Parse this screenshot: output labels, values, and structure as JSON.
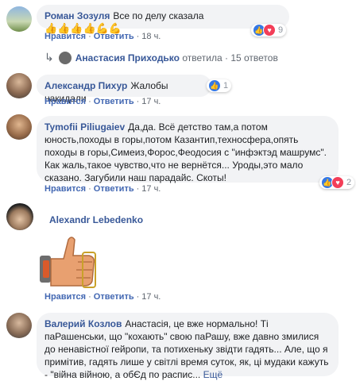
{
  "comments": [
    {
      "author": "Роман Зозуля",
      "text": "Все по делу сказала",
      "emoji": "👍👍👍👍💪💪",
      "like": "Нравится",
      "reply": "Ответить",
      "time": "18 ч.",
      "reactions": "9"
    },
    {
      "author": "Александр Пихур",
      "text": "Жалобы накидали",
      "like": "Нравится",
      "reply": "Ответить",
      "time": "17 ч.",
      "reactions": "1"
    },
    {
      "author": "Tymofii Piliugaiev",
      "text": "Да,да. Всё детство там,а потом юность,походы в горы,потом Казантип,техносфера,опять походы в горы,Симеиз,Форос,Феодосия с \"инфэктэд машрумс\". Как жаль,такое чувство,что не вернётся... Уроды,это мало сказано. Загубили наш парадайс. Скоты!",
      "like": "Нравится",
      "reply": "Ответить",
      "time": "17 ч.",
      "reactions": "2"
    },
    {
      "author": "Alexandr Lebedenko",
      "like": "Нравится",
      "reply": "Ответить",
      "time": "17 ч."
    },
    {
      "author": "Валерий Козлов",
      "text": "Анастасія, це вже нормально! Ті паРашенськи, що \"кохають\" свою паРашу, вже давно змилися до ненавістної гейропи, та потихеньку звідти гадять... Але, що я примітив, гадять лише у світлі время суток, як, ці мудаки кажуть - \"війна війною, а обЄд по распис...",
      "more": "Ещё"
    }
  ],
  "reply_summary": {
    "author": "Анастасия Приходько",
    "action": "ответила",
    "dot": "·",
    "count": "15 ответов"
  },
  "colors": {
    "link": "#4267b2",
    "author": "#385898",
    "bubble": "#f2f3f5"
  }
}
